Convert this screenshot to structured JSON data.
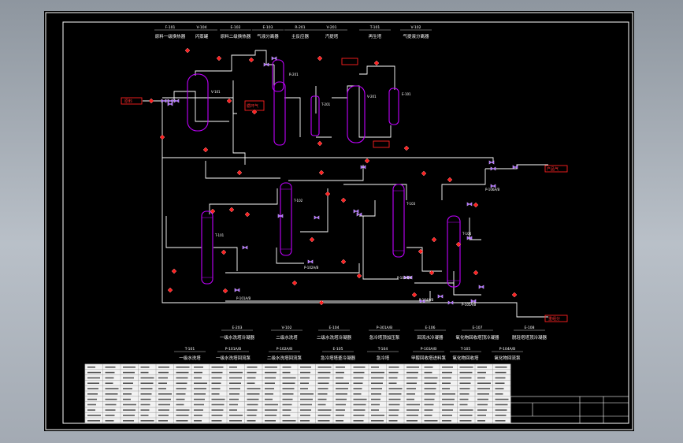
{
  "drawing": {
    "top_titles": [
      {
        "tag": "F-101",
        "name": "原料一级换热器"
      },
      {
        "tag": "V-104",
        "name": "闪蒸罐"
      },
      {
        "tag": "E-102",
        "name": "原料二级换热器"
      },
      {
        "tag": "E-103",
        "name": "气液分离器"
      },
      {
        "tag": "R-201",
        "name": "主反应器"
      },
      {
        "tag": "V-201",
        "name": "汽提塔"
      },
      {
        "tag": "T-101",
        "name": "再生塔"
      },
      {
        "tag": "V-102",
        "name": "气提液分离器"
      }
    ],
    "mid_titles": [
      {
        "tag": "E-203",
        "name": "一级水洗塔冷凝器"
      },
      {
        "tag": "V-102",
        "name": "二级水洗塔"
      },
      {
        "tag": "E-104",
        "name": "二级水洗塔冷凝器"
      },
      {
        "tag": "P-301A/B",
        "name": "急冷塔顶加压泵"
      },
      {
        "tag": "E-106",
        "name": "回流水冷凝器"
      },
      {
        "tag": "E-107",
        "name": "氧化物回收塔顶冷凝器"
      },
      {
        "tag": "E-108",
        "name": "脱轻塔塔顶冷凝器"
      }
    ],
    "bot_titles": [
      {
        "tag": "T-101",
        "name": "一级水洗塔"
      },
      {
        "tag": "P-101A/B",
        "name": "一级水洗塔回流泵"
      },
      {
        "tag": "P-102A/B",
        "name": "二级水洗塔回流泵"
      },
      {
        "tag": "E-105",
        "name": "急冷塔塔釜冷凝器"
      },
      {
        "tag": "T-104",
        "name": "急冷塔"
      },
      {
        "tag": "P-103A/B",
        "name": "甲醇回收塔进料泵"
      },
      {
        "tag": "T-105",
        "name": "氧化物回收塔"
      },
      {
        "tag": "P-104A/B",
        "name": "氧化物回流泵"
      }
    ],
    "equipment_tags": {
      "v1": "V-101",
      "v2": "R-201",
      "v3": "T-201",
      "v4": "V-201",
      "v5": "E-101",
      "t1": "T-101",
      "t2": "T-102",
      "t3": "T-103",
      "t4": "T-104",
      "p1": "P-101A/B",
      "p2": "P-102A/B",
      "p3": "P-103A/B",
      "p4": "P-104A/B",
      "p5": "P-105A/B",
      "p6": "P-106A/B"
    },
    "stream_labels": {
      "feed": "原料",
      "feed2": "循环气",
      "product": "产品气",
      "out_bottom": "重组分"
    },
    "colors": {
      "process_line": "#ffffff",
      "vessel": "#c000ff",
      "instrument": "#ff2020",
      "valve": "#b06cff",
      "border": "#ffffff",
      "table": "#e8e8e8"
    }
  }
}
